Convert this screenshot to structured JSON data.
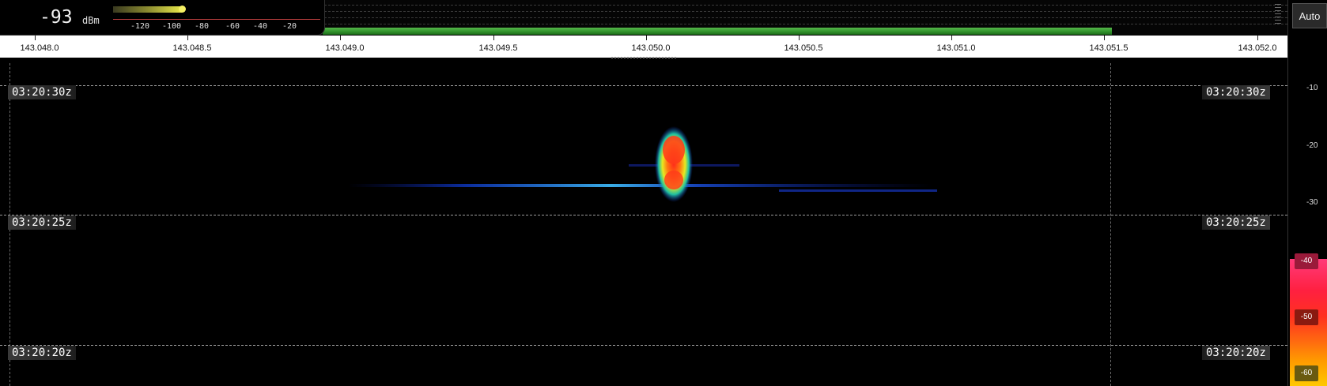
{
  "smeter": {
    "value": "-93",
    "unit": "dBm",
    "scale": [
      "-120",
      "-100",
      "-80",
      "-60",
      "-40",
      "-20"
    ]
  },
  "frequency_axis": {
    "labels": [
      "143.048.0",
      "143.048.5",
      "143.049.0",
      "143.049.5",
      "143.050.0",
      "143.050.5",
      "143.051.0",
      "143.051.5",
      "143.052.0"
    ]
  },
  "waterfall": {
    "time_labels": [
      "03:20:30z",
      "03:20:25z",
      "03:20:20z"
    ],
    "signal_center": "143.050.0"
  },
  "right_panel": {
    "auto_label": "Auto",
    "db_labels": [
      "-10",
      "-20",
      "-30"
    ],
    "color_scale_labels": [
      "-40",
      "-50",
      "-60"
    ]
  },
  "colors": {
    "background": "#000000",
    "signal_bar": "#3aa034",
    "ruler": "#ffffff",
    "smeter_bar": "#e6e64a"
  }
}
